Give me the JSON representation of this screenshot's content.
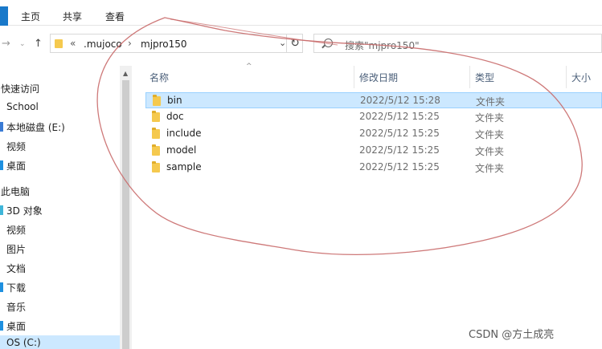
{
  "ribbon": {
    "tabs": [
      "主页",
      "共享",
      "查看"
    ]
  },
  "nav": {
    "back_icon": "back-arrow-icon",
    "forward_icon": "forward-arrow-icon",
    "recent_icon": "chevron-down-icon",
    "up_icon": "up-arrow-icon"
  },
  "address": {
    "overflow": "«",
    "crumbs": [
      ".mujoco",
      "mjpro150"
    ],
    "separator": "›",
    "dropdown": "⌄",
    "refresh": "↻"
  },
  "search": {
    "placeholder": "搜索\"mjpro150\""
  },
  "sidebar": {
    "items": [
      {
        "label": "快速访问",
        "marker": ""
      },
      {
        "label": "School",
        "marker": ""
      },
      {
        "label": "本地磁盘 (E:)",
        "marker": "#3a7bd5"
      },
      {
        "label": "视频",
        "marker": ""
      },
      {
        "label": "桌面",
        "marker": "#1e90e0"
      },
      {
        "label": "此电脑",
        "marker": ""
      },
      {
        "label": "3D 对象",
        "marker": "#3fb6d9"
      },
      {
        "label": "视频",
        "marker": ""
      },
      {
        "label": "图片",
        "marker": ""
      },
      {
        "label": "文档",
        "marker": ""
      },
      {
        "label": "下载",
        "marker": "#1e90e0"
      },
      {
        "label": "音乐",
        "marker": ""
      },
      {
        "label": "桌面",
        "marker": "#1e90e0"
      },
      {
        "label": "OS (C:)",
        "marker": ""
      }
    ],
    "selected_index": 13
  },
  "columns": {
    "name": "名称",
    "date": "修改日期",
    "type": "类型",
    "size": "大小"
  },
  "files": [
    {
      "name": "bin",
      "date": "2022/5/12 15:28",
      "type": "文件夹",
      "selected": true
    },
    {
      "name": "doc",
      "date": "2022/5/12 15:25",
      "type": "文件夹",
      "selected": false
    },
    {
      "name": "include",
      "date": "2022/5/12 15:25",
      "type": "文件夹",
      "selected": false
    },
    {
      "name": "model",
      "date": "2022/5/12 15:25",
      "type": "文件夹",
      "selected": false
    },
    {
      "name": "sample",
      "date": "2022/5/12 15:25",
      "type": "文件夹",
      "selected": false
    }
  ],
  "watermark": "CSDN @方土成亮",
  "colors": {
    "selection": "#cce8ff",
    "selection_border": "#99d1ff",
    "accent": "#1979ca",
    "folder": "#f5c94e",
    "annotation": "#c96a6a"
  }
}
